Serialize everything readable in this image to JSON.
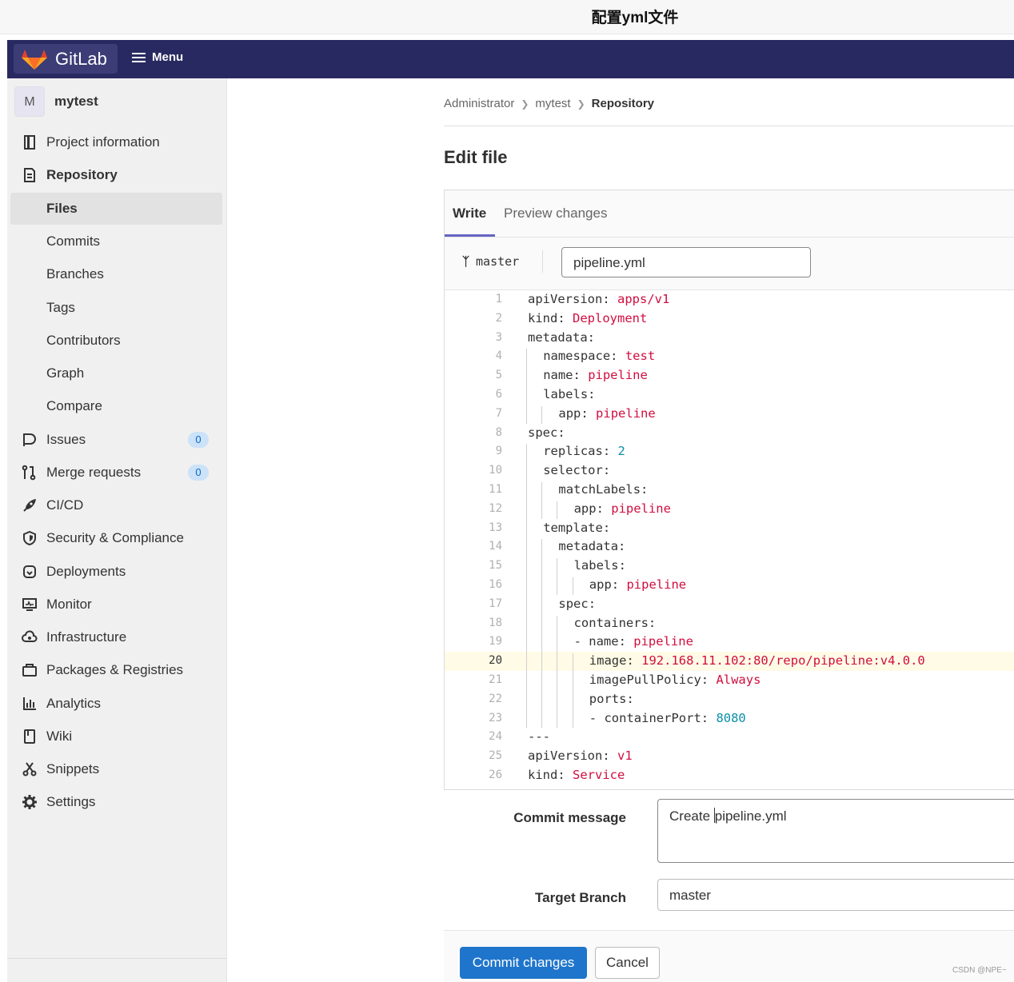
{
  "caption": "配置yml文件",
  "header": {
    "logo_text": "GitLab",
    "menu_label": "Menu"
  },
  "sidebar": {
    "project_initial": "M",
    "project_name": "mytest",
    "items": [
      {
        "label": "Project information",
        "icon": "project-info-icon"
      },
      {
        "label": "Repository",
        "icon": "repository-icon"
      },
      {
        "label": "Files"
      },
      {
        "label": "Commits"
      },
      {
        "label": "Branches"
      },
      {
        "label": "Tags"
      },
      {
        "label": "Contributors"
      },
      {
        "label": "Graph"
      },
      {
        "label": "Compare"
      },
      {
        "label": "Issues",
        "icon": "issues-icon",
        "badge": "0"
      },
      {
        "label": "Merge requests",
        "icon": "merge-request-icon",
        "badge": "0"
      },
      {
        "label": "CI/CD",
        "icon": "rocket-icon"
      },
      {
        "label": "Security & Compliance",
        "icon": "shield-icon"
      },
      {
        "label": "Deployments",
        "icon": "deployments-icon"
      },
      {
        "label": "Monitor",
        "icon": "monitor-icon"
      },
      {
        "label": "Infrastructure",
        "icon": "cloud-icon"
      },
      {
        "label": "Packages & Registries",
        "icon": "package-icon"
      },
      {
        "label": "Analytics",
        "icon": "chart-icon"
      },
      {
        "label": "Wiki",
        "icon": "book-icon"
      },
      {
        "label": "Snippets",
        "icon": "snippet-icon"
      },
      {
        "label": "Settings",
        "icon": "gear-icon"
      }
    ]
  },
  "breadcrumbs": [
    "Administrator",
    "mytest",
    "Repository"
  ],
  "page_title": "Edit file",
  "editor": {
    "tab_write": "Write",
    "tab_preview": "Preview changes",
    "branch": "master",
    "file_name": "pipeline.yml",
    "current_line": 20,
    "lines": [
      {
        "n": "1",
        "indent": 0,
        "key": "apiVersion:",
        "val": " apps/v1",
        "t": "str"
      },
      {
        "n": "2",
        "indent": 0,
        "key": "kind:",
        "val": " Deployment",
        "t": "str"
      },
      {
        "n": "3",
        "indent": 0,
        "key": "metadata:",
        "val": "",
        "t": "str"
      },
      {
        "n": "4",
        "indent": 1,
        "key": "namespace:",
        "val": " test",
        "t": "str"
      },
      {
        "n": "5",
        "indent": 1,
        "key": "name:",
        "val": " pipeline",
        "t": "str"
      },
      {
        "n": "6",
        "indent": 1,
        "key": "labels:",
        "val": "",
        "t": "str"
      },
      {
        "n": "7",
        "indent": 2,
        "key": "app:",
        "val": " pipeline",
        "t": "str"
      },
      {
        "n": "8",
        "indent": 0,
        "key": "spec:",
        "val": "",
        "t": "str"
      },
      {
        "n": "9",
        "indent": 1,
        "key": "replicas:",
        "val": " 2",
        "t": "num"
      },
      {
        "n": "10",
        "indent": 1,
        "key": "selector:",
        "val": "",
        "t": "str"
      },
      {
        "n": "11",
        "indent": 2,
        "key": "matchLabels:",
        "val": "",
        "t": "str"
      },
      {
        "n": "12",
        "indent": 3,
        "key": "app:",
        "val": " pipeline",
        "t": "str"
      },
      {
        "n": "13",
        "indent": 1,
        "key": "template:",
        "val": "",
        "t": "str"
      },
      {
        "n": "14",
        "indent": 2,
        "key": "metadata:",
        "val": "",
        "t": "str"
      },
      {
        "n": "15",
        "indent": 3,
        "key": "labels:",
        "val": "",
        "t": "str"
      },
      {
        "n": "16",
        "indent": 4,
        "key": "app:",
        "val": " pipeline",
        "t": "str"
      },
      {
        "n": "17",
        "indent": 2,
        "key": "spec:",
        "val": "",
        "t": "str"
      },
      {
        "n": "18",
        "indent": 3,
        "key": "containers:",
        "val": "",
        "t": "str"
      },
      {
        "n": "19",
        "indent": 3,
        "key": "- name:",
        "val": " pipeline",
        "t": "str"
      },
      {
        "n": "20",
        "indent": 4,
        "key": "image:",
        "val": " 192.168.11.102:80/repo/pipeline:v4.0.0",
        "t": "str"
      },
      {
        "n": "21",
        "indent": 4,
        "key": "imagePullPolicy:",
        "val": " Always",
        "t": "str"
      },
      {
        "n": "22",
        "indent": 4,
        "key": "ports:",
        "val": "",
        "t": "str"
      },
      {
        "n": "23",
        "indent": 4,
        "key": "- containerPort:",
        "val": " 8080",
        "t": "num"
      },
      {
        "n": "24",
        "indent": 0,
        "key": "---",
        "val": "",
        "t": "str"
      },
      {
        "n": "25",
        "indent": 0,
        "key": "apiVersion:",
        "val": " v1",
        "t": "str"
      },
      {
        "n": "26",
        "indent": 0,
        "key": "kind:",
        "val": " Service",
        "t": "str"
      }
    ]
  },
  "commit": {
    "message_label": "Commit message",
    "message_before_caret": "Create ",
    "message_after_caret": "pipeline.yml",
    "branch_label": "Target Branch",
    "branch_value": "master",
    "commit_button": "Commit changes",
    "cancel_button": "Cancel"
  },
  "watermark": "CSDN @NPE~"
}
